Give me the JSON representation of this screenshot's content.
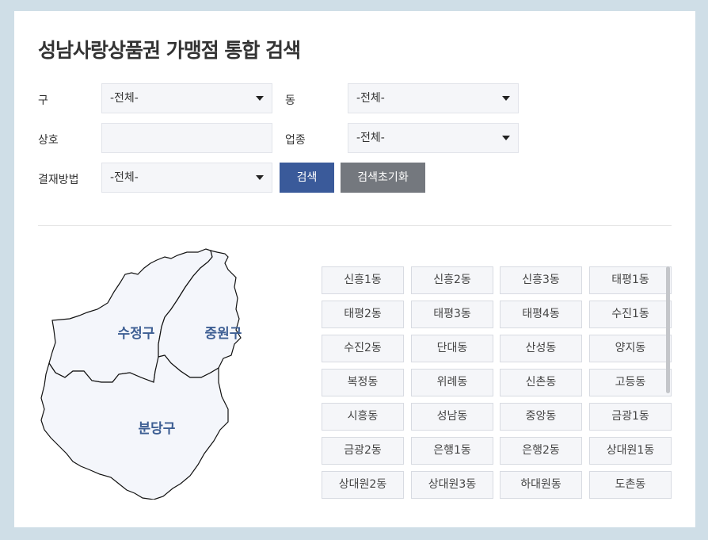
{
  "title": "성남사랑상품권 가맹점 통합 검색",
  "form": {
    "gu_label": "구",
    "gu_value": "-전체-",
    "dong_label": "동",
    "dong_value": "-전체-",
    "name_label": "상호",
    "name_value": "",
    "category_label": "업종",
    "category_value": "-전체-",
    "payment_label": "결재방법",
    "payment_value": "-전체-",
    "search_button": "검색",
    "reset_button": "검색초기화"
  },
  "map": {
    "districts": [
      "수정구",
      "중원구",
      "분당구"
    ]
  },
  "dongs": [
    "신흥1동",
    "신흥2동",
    "신흥3동",
    "태평1동",
    "태평2동",
    "태평3동",
    "태평4동",
    "수진1동",
    "수진2동",
    "단대동",
    "산성동",
    "양지동",
    "복정동",
    "위례동",
    "신촌동",
    "고등동",
    "시흥동",
    "성남동",
    "중앙동",
    "금광1동",
    "금광2동",
    "은행1동",
    "은행2동",
    "상대원1동",
    "상대원2동",
    "상대원3동",
    "하대원동",
    "도촌동"
  ]
}
